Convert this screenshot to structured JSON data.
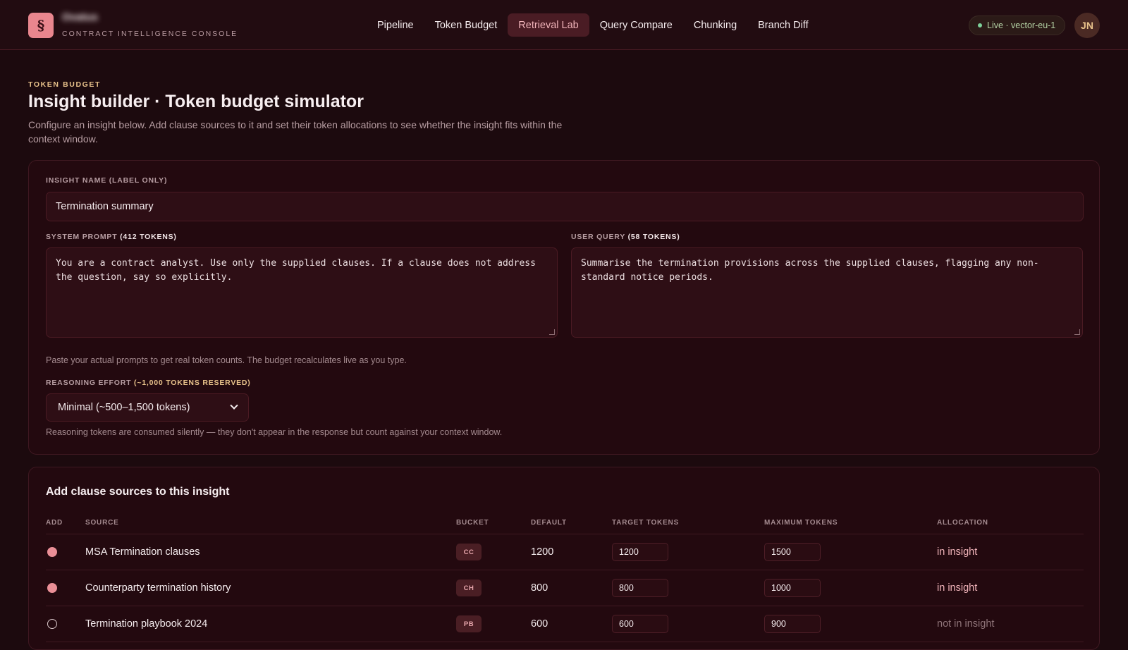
{
  "brand": {
    "logo_glyph": "§",
    "name": "Ovatus",
    "subtitle": "CONTRACT INTELLIGENCE CONSOLE"
  },
  "nav": [
    {
      "label": "Pipeline",
      "active": false
    },
    {
      "label": "Token Budget",
      "active": false
    },
    {
      "label": "Retrieval Lab",
      "active": true
    },
    {
      "label": "Query Compare",
      "active": false
    },
    {
      "label": "Chunking",
      "active": false
    },
    {
      "label": "Branch Diff",
      "active": false
    }
  ],
  "status": {
    "label": "Live · vector-eu-1",
    "color": "#7ed29a"
  },
  "user": {
    "initials": "JN"
  },
  "header": {
    "eyebrow": "TOKEN BUDGET",
    "title": "Insight builder · Token budget simulator",
    "description": "Configure an insight below. Add clause sources to it and set their token allocations to see whether the insight fits within the context window."
  },
  "config": {
    "name_label": "INSIGHT NAME (LABEL ONLY)",
    "name_value": "Termination summary",
    "system_label": "SYSTEM PROMPT",
    "system_tokens": "(412 TOKENS)",
    "system_value": "You are a contract analyst. Use only the supplied clauses. If a clause does not address the question, say so explicitly.",
    "query_label": "USER QUERY",
    "query_tokens": "(58 TOKENS)",
    "query_value": "Summarise the termination provisions across the supplied clauses, flagging any non-standard notice periods.",
    "prompt_hint": "Paste your actual prompts to get real token counts. The budget recalculates live as you type.",
    "reasoning_label": "REASONING EFFORT",
    "reasoning_reserved": "(~1,000 TOKENS RESERVED)",
    "reasoning_value": "Minimal (~500–1,500 tokens)",
    "reasoning_hint": "Reasoning tokens are consumed silently — they don't appear in the response but count against your context window."
  },
  "sources": {
    "title": "Add clause sources to this insight",
    "columns": {
      "add": "ADD",
      "source": "SOURCE",
      "bucket": "BUCKET",
      "default": "DEFAULT",
      "target": "TARGET TOKENS",
      "max": "MAXIMUM TOKENS",
      "allocation": "ALLOCATION"
    },
    "rows": [
      {
        "checked": true,
        "name": "MSA Termination clauses",
        "bucket": "CC",
        "default": "1200",
        "target": "1200",
        "max": "1500",
        "allocation": "in insight"
      },
      {
        "checked": true,
        "name": "Counterparty termination history",
        "bucket": "CH",
        "default": "800",
        "target": "800",
        "max": "1000",
        "allocation": "in insight"
      },
      {
        "checked": false,
        "name": "Termination playbook 2024",
        "bucket": "PB",
        "default": "600",
        "target": "600",
        "max": "900",
        "allocation": "not in insight"
      }
    ]
  },
  "colors": {
    "background": "#1c0a0e",
    "accent": "#ea8f97",
    "eyebrow": "#e8c28b"
  }
}
